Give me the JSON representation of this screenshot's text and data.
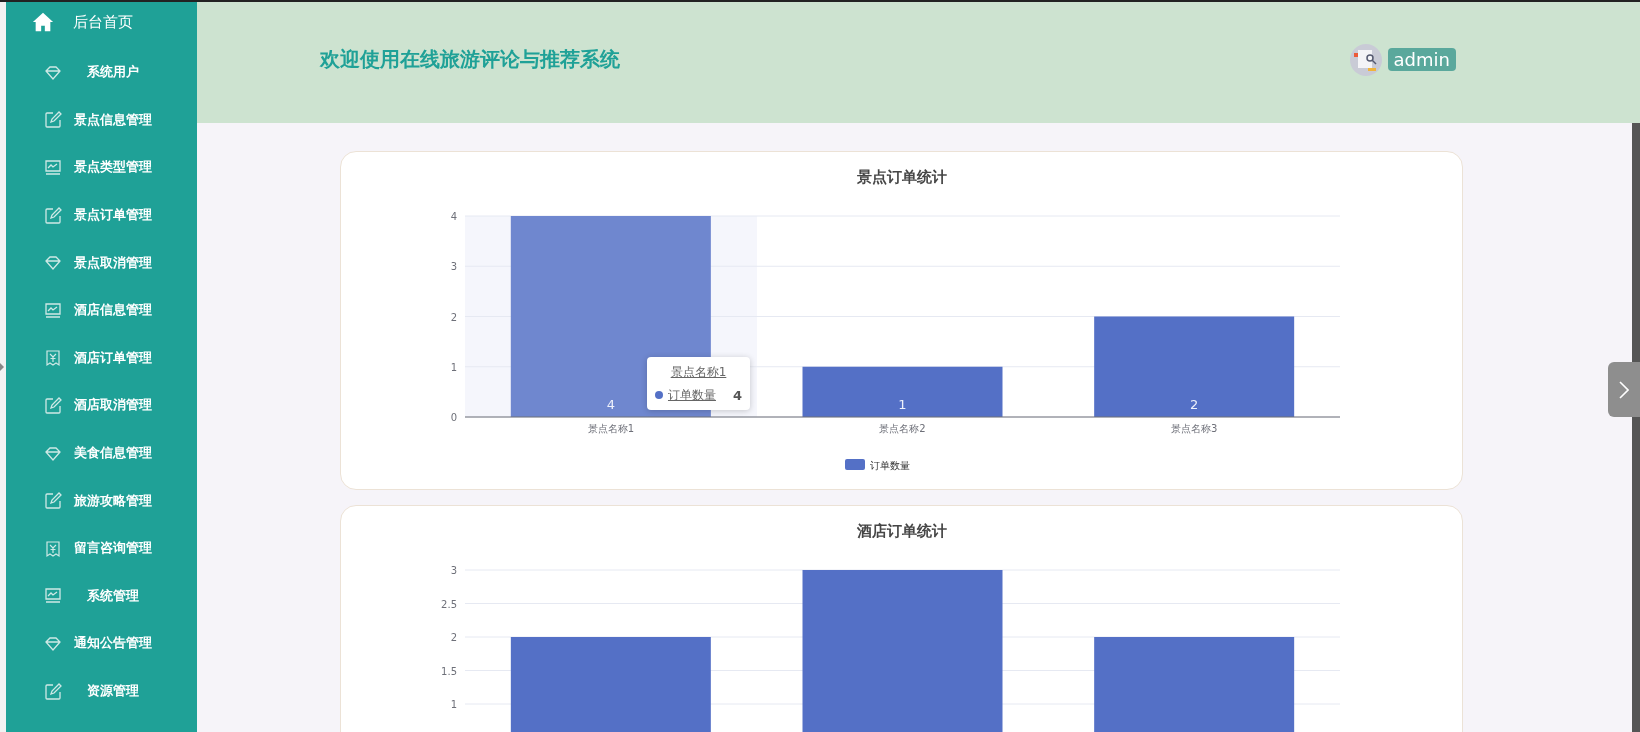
{
  "sidebar": {
    "home": {
      "label": "后台首页"
    },
    "items": [
      {
        "label": "系统用户",
        "kind": "gem"
      },
      {
        "label": "景点信息管理",
        "kind": "edit"
      },
      {
        "label": "景点类型管理",
        "kind": "monitor"
      },
      {
        "label": "景点订单管理",
        "kind": "edit"
      },
      {
        "label": "景点取消管理",
        "kind": "gem"
      },
      {
        "label": "酒店信息管理",
        "kind": "monitor"
      },
      {
        "label": "酒店订单管理",
        "kind": "receipt"
      },
      {
        "label": "酒店取消管理",
        "kind": "edit"
      },
      {
        "label": "美食信息管理",
        "kind": "gem"
      },
      {
        "label": "旅游攻略管理",
        "kind": "edit"
      },
      {
        "label": "留言咨询管理",
        "kind": "receipt"
      },
      {
        "label": "系统管理",
        "kind": "monitor"
      },
      {
        "label": "通知公告管理",
        "kind": "gem"
      },
      {
        "label": "资源管理",
        "kind": "edit"
      }
    ]
  },
  "header": {
    "title": "欢迎使用在线旅游评论与推荐系统",
    "user": "admin"
  },
  "charts": [
    {
      "chart_data": {
        "type": "bar",
        "title": "景点订单统计",
        "categories": [
          "景点名称1",
          "景点名称2",
          "景点名称3"
        ],
        "series": [
          {
            "name": "订单数量",
            "color": "#5470c6",
            "values": [
              4,
              1,
              2
            ]
          }
        ],
        "ylim": [
          0,
          4
        ],
        "yticks": [
          0,
          1,
          2,
          3,
          4
        ],
        "grid": true,
        "data_labels": true
      },
      "bars": [
        {
          "hovered": true
        },
        {
          "hovered": false
        },
        {
          "hovered": false
        }
      ],
      "tooltip": {
        "title": "景点名称1",
        "label": "订单数量",
        "value": "4"
      }
    },
    {
      "chart_data": {
        "type": "bar",
        "title": "酒店订单统计",
        "series": [
          {
            "color": "#5470c6",
            "values": [
              2,
              3,
              2
            ]
          }
        ],
        "ylim": [
          0,
          3
        ],
        "yticks": [
          1,
          1.5,
          2,
          2.5,
          3
        ],
        "grid": true
      }
    }
  ]
}
